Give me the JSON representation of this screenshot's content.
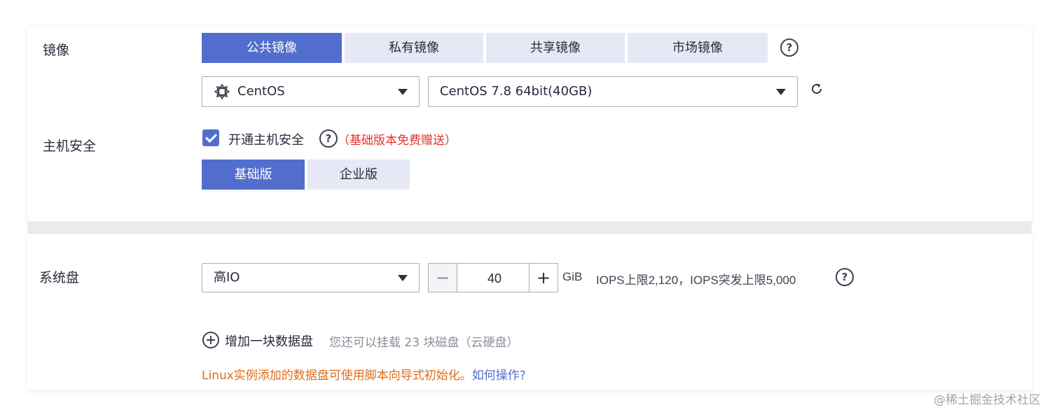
{
  "image_section": {
    "label": "镜像",
    "tabs": [
      {
        "label": "公共镜像",
        "active": true
      },
      {
        "label": "私有镜像",
        "active": false
      },
      {
        "label": "共享镜像",
        "active": false
      },
      {
        "label": "市场镜像",
        "active": false
      }
    ],
    "help_icon": "question-circle-icon",
    "os_select": {
      "value": "CentOS",
      "icon": "centos-logo-icon"
    },
    "version_select": {
      "value": "CentOS 7.8 64bit(40GB)"
    },
    "refresh_icon": "refresh-icon"
  },
  "host_security": {
    "label": "主机安全",
    "checkbox_checked": true,
    "checkbox_label": "开通主机安全",
    "help_icon": "question-circle-icon",
    "note": "（基础版本免费赠送）",
    "note_color": "#e0332f",
    "editions": [
      {
        "label": "基础版",
        "active": true
      },
      {
        "label": "企业版",
        "active": false
      }
    ]
  },
  "system_disk": {
    "label": "系统盘",
    "type_select": {
      "value": "高IO"
    },
    "size_value": "40",
    "unit": "GiB",
    "iops_text": "IOPS上限2,120，IOPS突发上限5,000",
    "help_icon": "question-circle-icon",
    "add_disk_label": "增加一块数据盘",
    "add_disk_hint": "您还可以挂载 23 块磁盘（云硬盘）",
    "linux_note": "Linux实例添加的数据盘可使用脚本向导式初始化。",
    "linux_note_color": "#e06c1b",
    "how_to_link": "如何操作?",
    "link_color": "#526ecc"
  },
  "watermark": "@稀土掘金技术社区",
  "colors": {
    "accent": "#526ecc",
    "tab_inactive": "#e6e9f5"
  }
}
